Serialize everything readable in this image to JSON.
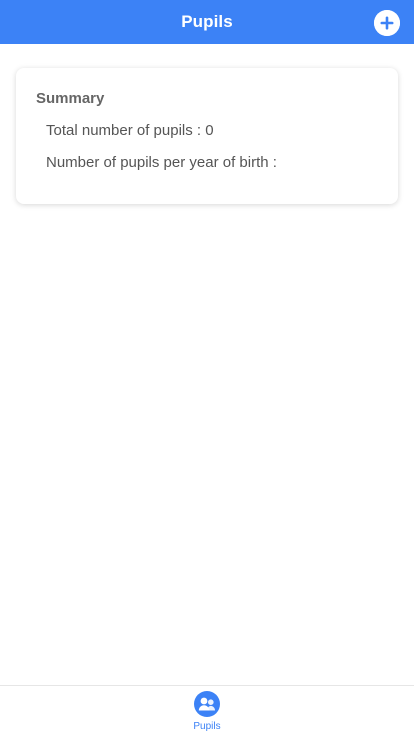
{
  "header": {
    "title": "Pupils",
    "add_icon": "plus-circle-icon"
  },
  "summary": {
    "title": "Summary",
    "total_pupils": "Total number of pupils : 0",
    "per_year_of_birth": "Number of pupils per year of birth :"
  },
  "tabbar": {
    "tabs": [
      {
        "label": "Pupils",
        "icon": "users-icon",
        "active": true
      }
    ]
  },
  "colors": {
    "accent": "#3c82f6",
    "text_title": "#666666",
    "text_body": "#555555"
  }
}
